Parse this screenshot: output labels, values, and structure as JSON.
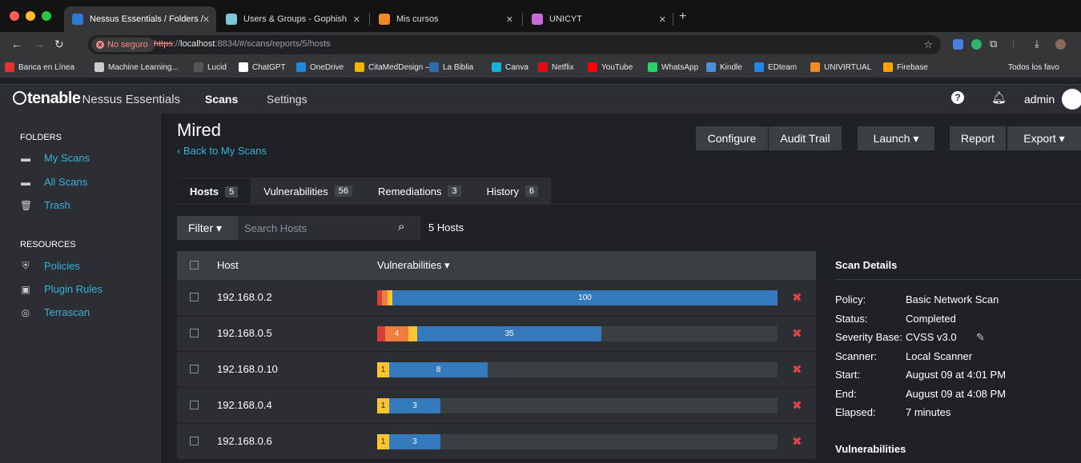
{
  "browser": {
    "tabs": [
      {
        "title": "Nessus Essentials / Folders / ",
        "close": "✕",
        "color": "#2d7bd4",
        "active": true
      },
      {
        "title": "Users & Groups - Gophish",
        "close": "✕",
        "color": "#7cc7d8",
        "active": false
      },
      {
        "title": "Mis cursos",
        "close": "✕",
        "color": "#f38a26",
        "active": false
      },
      {
        "title": "UNICYT",
        "close": "✕",
        "color": "#c86bd6",
        "active": false
      }
    ],
    "new_tab": "+",
    "not_secure": "No seguro",
    "url_scheme": "https",
    "url_sep": "://",
    "url_host": "localhost",
    "url_rest": ":8834/#/scans/reports/5/hosts",
    "bookmarks": [
      {
        "label": "Banca en Línea",
        "color": "#e3342f"
      },
      {
        "label": "Machine Learning...",
        "color": "#cccccc"
      },
      {
        "label": "Lucid",
        "color": "#555555"
      },
      {
        "label": "ChatGPT",
        "color": "#ffffff"
      },
      {
        "label": "OneDrive",
        "color": "#1e88e5"
      },
      {
        "label": "CitaMedDesign –...",
        "color": "#f5b400"
      },
      {
        "label": "La Biblia",
        "color": "#2f6bb3"
      },
      {
        "label": "Canva",
        "color": "#17b1d9"
      },
      {
        "label": "Netflix",
        "color": "#e50914"
      },
      {
        "label": "YouTube",
        "color": "#ff0000"
      },
      {
        "label": "WhatsApp",
        "color": "#25d366"
      },
      {
        "label": "Kindle",
        "color": "#4a90d9"
      },
      {
        "label": "EDteam",
        "color": "#1e88e5"
      },
      {
        "label": "UNIVIRTUAL",
        "color": "#f38a26"
      },
      {
        "label": "Firebase",
        "color": "#ffa000"
      },
      {
        "label": "Todos los favo",
        "color": "#35363a"
      }
    ]
  },
  "app": {
    "brand": "tenable",
    "product": "Nessus Essentials",
    "nav": [
      "Scans",
      "Settings"
    ],
    "user": "admin"
  },
  "sidebar": {
    "folders_heading": "FOLDERS",
    "folders": [
      {
        "label": "My Scans",
        "icon": "folder-icon"
      },
      {
        "label": "All Scans",
        "icon": "folder-icon"
      },
      {
        "label": "Trash",
        "icon": "trash-icon"
      }
    ],
    "resources_heading": "RESOURCES",
    "resources": [
      {
        "label": "Policies",
        "icon": "shield-icon"
      },
      {
        "label": "Plugin Rules",
        "icon": "plugin-icon"
      },
      {
        "label": "Terrascan",
        "icon": "terrascan-icon"
      }
    ]
  },
  "page": {
    "title": "Mired",
    "back": "‹ Back to My Scans",
    "buttons": {
      "configure": "Configure",
      "audit": "Audit Trail",
      "launch": "Launch ▾",
      "report": "Report",
      "export": "Export ▾"
    }
  },
  "tabs": [
    {
      "label": "Hosts",
      "count": "5",
      "active": true
    },
    {
      "label": "Vulnerabilities",
      "count": "56",
      "active": false
    },
    {
      "label": "Remediations",
      "count": "3",
      "active": false
    },
    {
      "label": "History",
      "count": "6",
      "active": false
    }
  ],
  "filter": {
    "label": "Filter ▾",
    "placeholder": "Search Hosts",
    "count_label": "5 Hosts"
  },
  "table": {
    "col_host": "Host",
    "col_vulns": "Vulnerabilities ▾",
    "severity_colors": {
      "critical": "#d43f3a",
      "high": "#ee7d3e",
      "medium": "#fdc431",
      "low": "#3fae49",
      "info": "#357abd"
    },
    "rows": [
      {
        "host": "192.168.0.2",
        "segments": [
          {
            "sev": "critical",
            "pct": 1.2,
            "label": ""
          },
          {
            "sev": "high",
            "pct": 1.4,
            "label": ""
          },
          {
            "sev": "medium",
            "pct": 1.2,
            "label": ""
          },
          {
            "sev": "info",
            "pct": 96.2,
            "label": "100"
          }
        ]
      },
      {
        "host": "192.168.0.5",
        "segments": [
          {
            "sev": "critical",
            "pct": 2.0,
            "label": ""
          },
          {
            "sev": "high",
            "pct": 5.8,
            "label": "4"
          },
          {
            "sev": "medium",
            "pct": 2.2,
            "label": ""
          },
          {
            "sev": "info",
            "pct": 46.0,
            "label": "35"
          }
        ]
      },
      {
        "host": "192.168.0.10",
        "segments": [
          {
            "sev": "medium",
            "pct": 3.0,
            "label": "1"
          },
          {
            "sev": "info",
            "pct": 24.6,
            "label": "8"
          }
        ]
      },
      {
        "host": "192.168.0.4",
        "segments": [
          {
            "sev": "medium",
            "pct": 3.0,
            "label": "1"
          },
          {
            "sev": "info",
            "pct": 12.8,
            "label": "3"
          }
        ]
      },
      {
        "host": "192.168.0.6",
        "segments": [
          {
            "sev": "medium",
            "pct": 3.0,
            "label": "1"
          },
          {
            "sev": "info",
            "pct": 12.8,
            "label": "3"
          }
        ]
      }
    ]
  },
  "details": {
    "heading": "Scan Details",
    "rows": [
      {
        "key": "Policy:",
        "value": "Basic Network Scan"
      },
      {
        "key": "Status:",
        "value": "Completed"
      },
      {
        "key": "Severity Base:",
        "value": "CVSS v3.0"
      },
      {
        "key": "Scanner:",
        "value": "Local Scanner"
      },
      {
        "key": "Start:",
        "value": "August 09 at 4:01 PM"
      },
      {
        "key": "End:",
        "value": "August 09 at 4:08 PM"
      },
      {
        "key": "Elapsed:",
        "value": "7 minutes"
      }
    ],
    "vulns_heading": "Vulnerabilities"
  }
}
